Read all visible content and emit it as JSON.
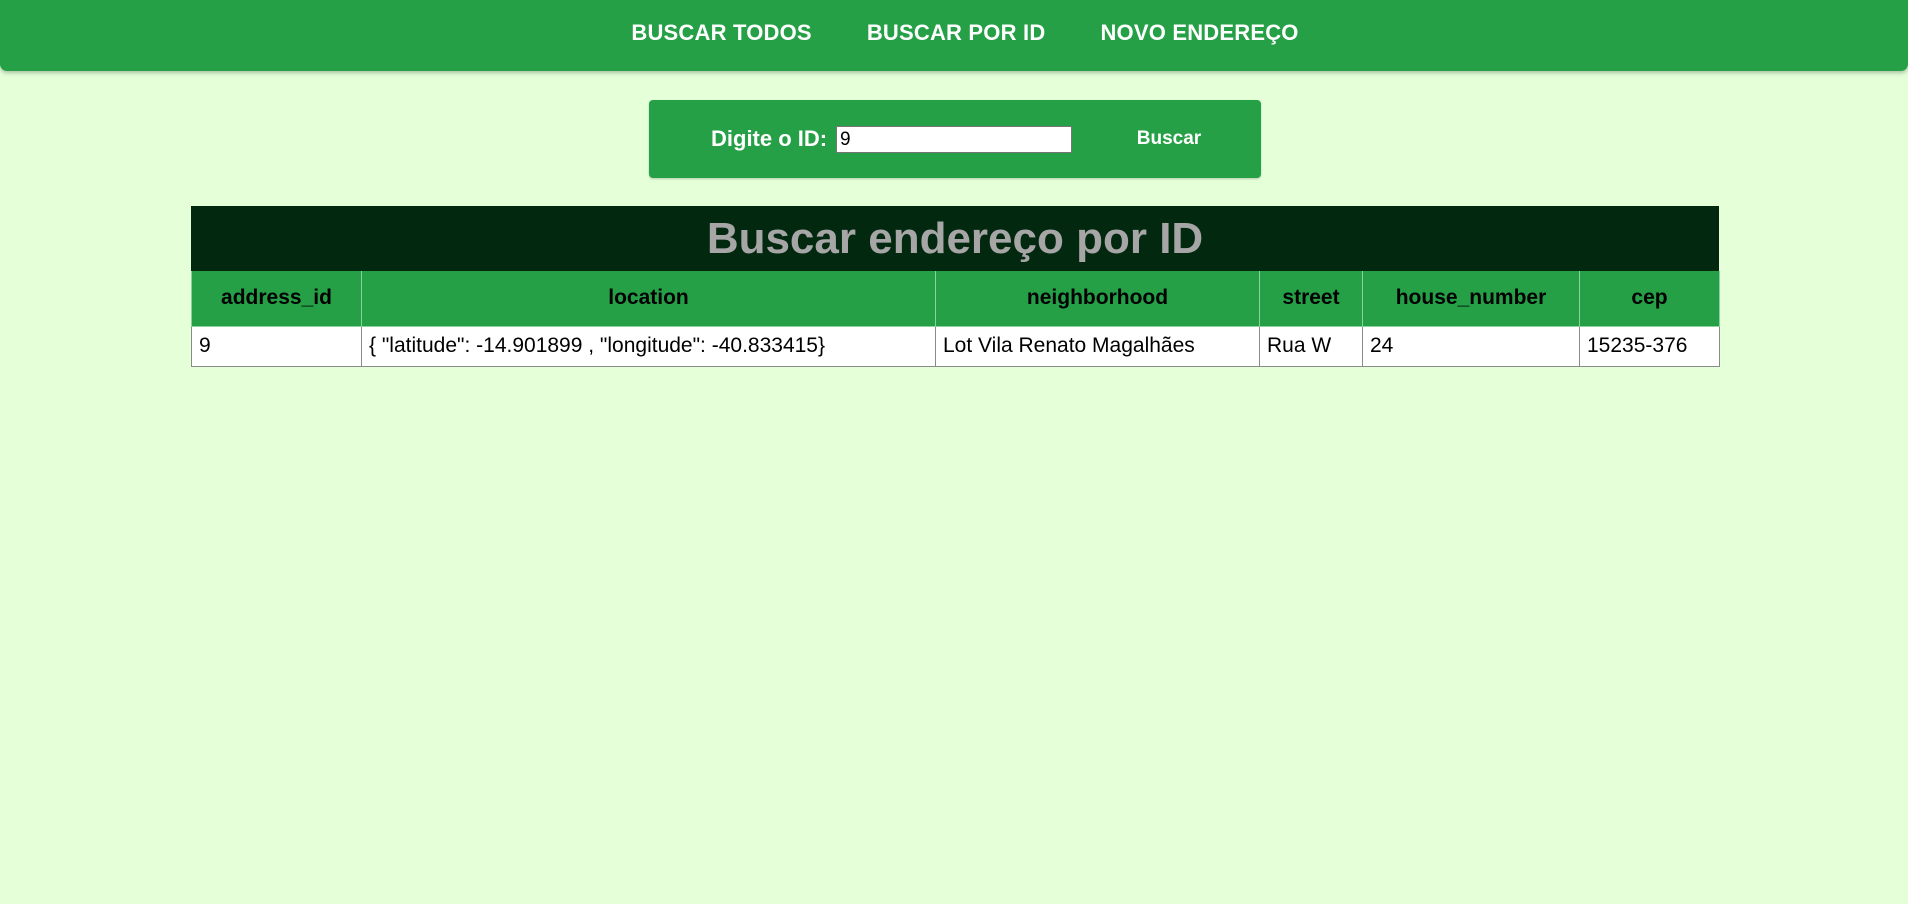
{
  "nav": {
    "items": [
      {
        "label": "BUSCAR TODOS"
      },
      {
        "label": "BUSCAR POR ID"
      },
      {
        "label": "NOVO ENDEREÇO"
      }
    ]
  },
  "search": {
    "label": "Digite o ID:",
    "value": "9",
    "button_label": "Buscar"
  },
  "table": {
    "title": "Buscar endereço por ID",
    "columns": [
      "address_id",
      "location",
      "neighborhood",
      "street",
      "house_number",
      "cep"
    ],
    "rows": [
      [
        "9",
        "{ \"latitude\": -14.901899 , \"longitude\": -40.833415}",
        "Lot Vila Renato Magalhães",
        "Rua W",
        "24",
        "15235-376"
      ]
    ]
  },
  "colors": {
    "page_background": "#e5ffd9",
    "primary_green": "#26a046",
    "title_bar": "#022910",
    "title_text": "#a6a6a6"
  }
}
